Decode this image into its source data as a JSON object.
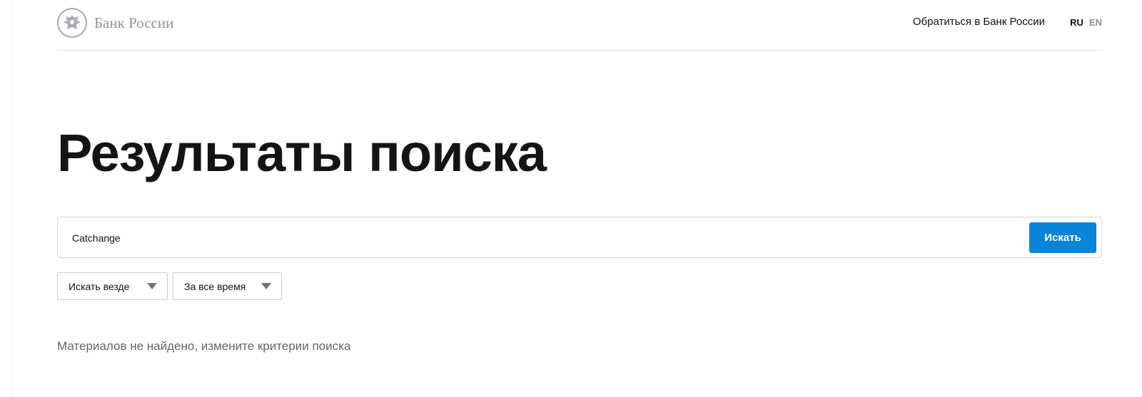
{
  "header": {
    "logo_text": "Банк России",
    "contact_link": "Обратиться в Банк России",
    "lang": {
      "ru": "RU",
      "en": "EN"
    }
  },
  "main": {
    "title": "Результаты поиска",
    "search": {
      "value": "Catchange",
      "button_label": "Искать"
    },
    "filters": {
      "area": "Искать везде",
      "time": "За все время"
    },
    "no_results_text": "Материалов не найдено, измените критерии поиска"
  },
  "colors": {
    "accent": "#0a84d6",
    "logo_gray": "#8e949a",
    "muted_text": "#5f666d"
  },
  "icons": {
    "logo": "eagle-emblem-icon",
    "dropdown": "caret-down-icon"
  }
}
